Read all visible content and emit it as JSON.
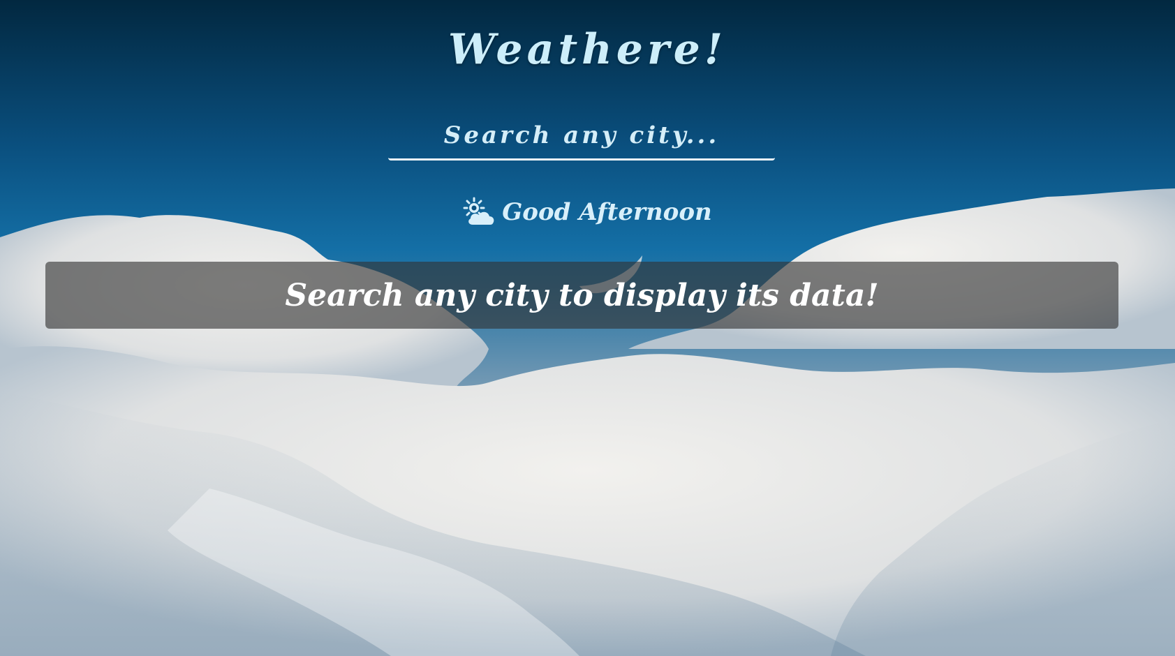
{
  "app": {
    "title": "Weathere!"
  },
  "search": {
    "placeholder": "Search any city...",
    "value": ""
  },
  "greeting": {
    "icon": "sun-cloud-icon",
    "text": "Good Afternoon"
  },
  "result": {
    "message": "Search any city to display its data!"
  },
  "colors": {
    "title": "#cdeefa",
    "sky_top": "#022840",
    "sky_mid": "#146fa6",
    "panel": "rgba(50,50,50,0.62)",
    "text_white": "#ffffff"
  }
}
